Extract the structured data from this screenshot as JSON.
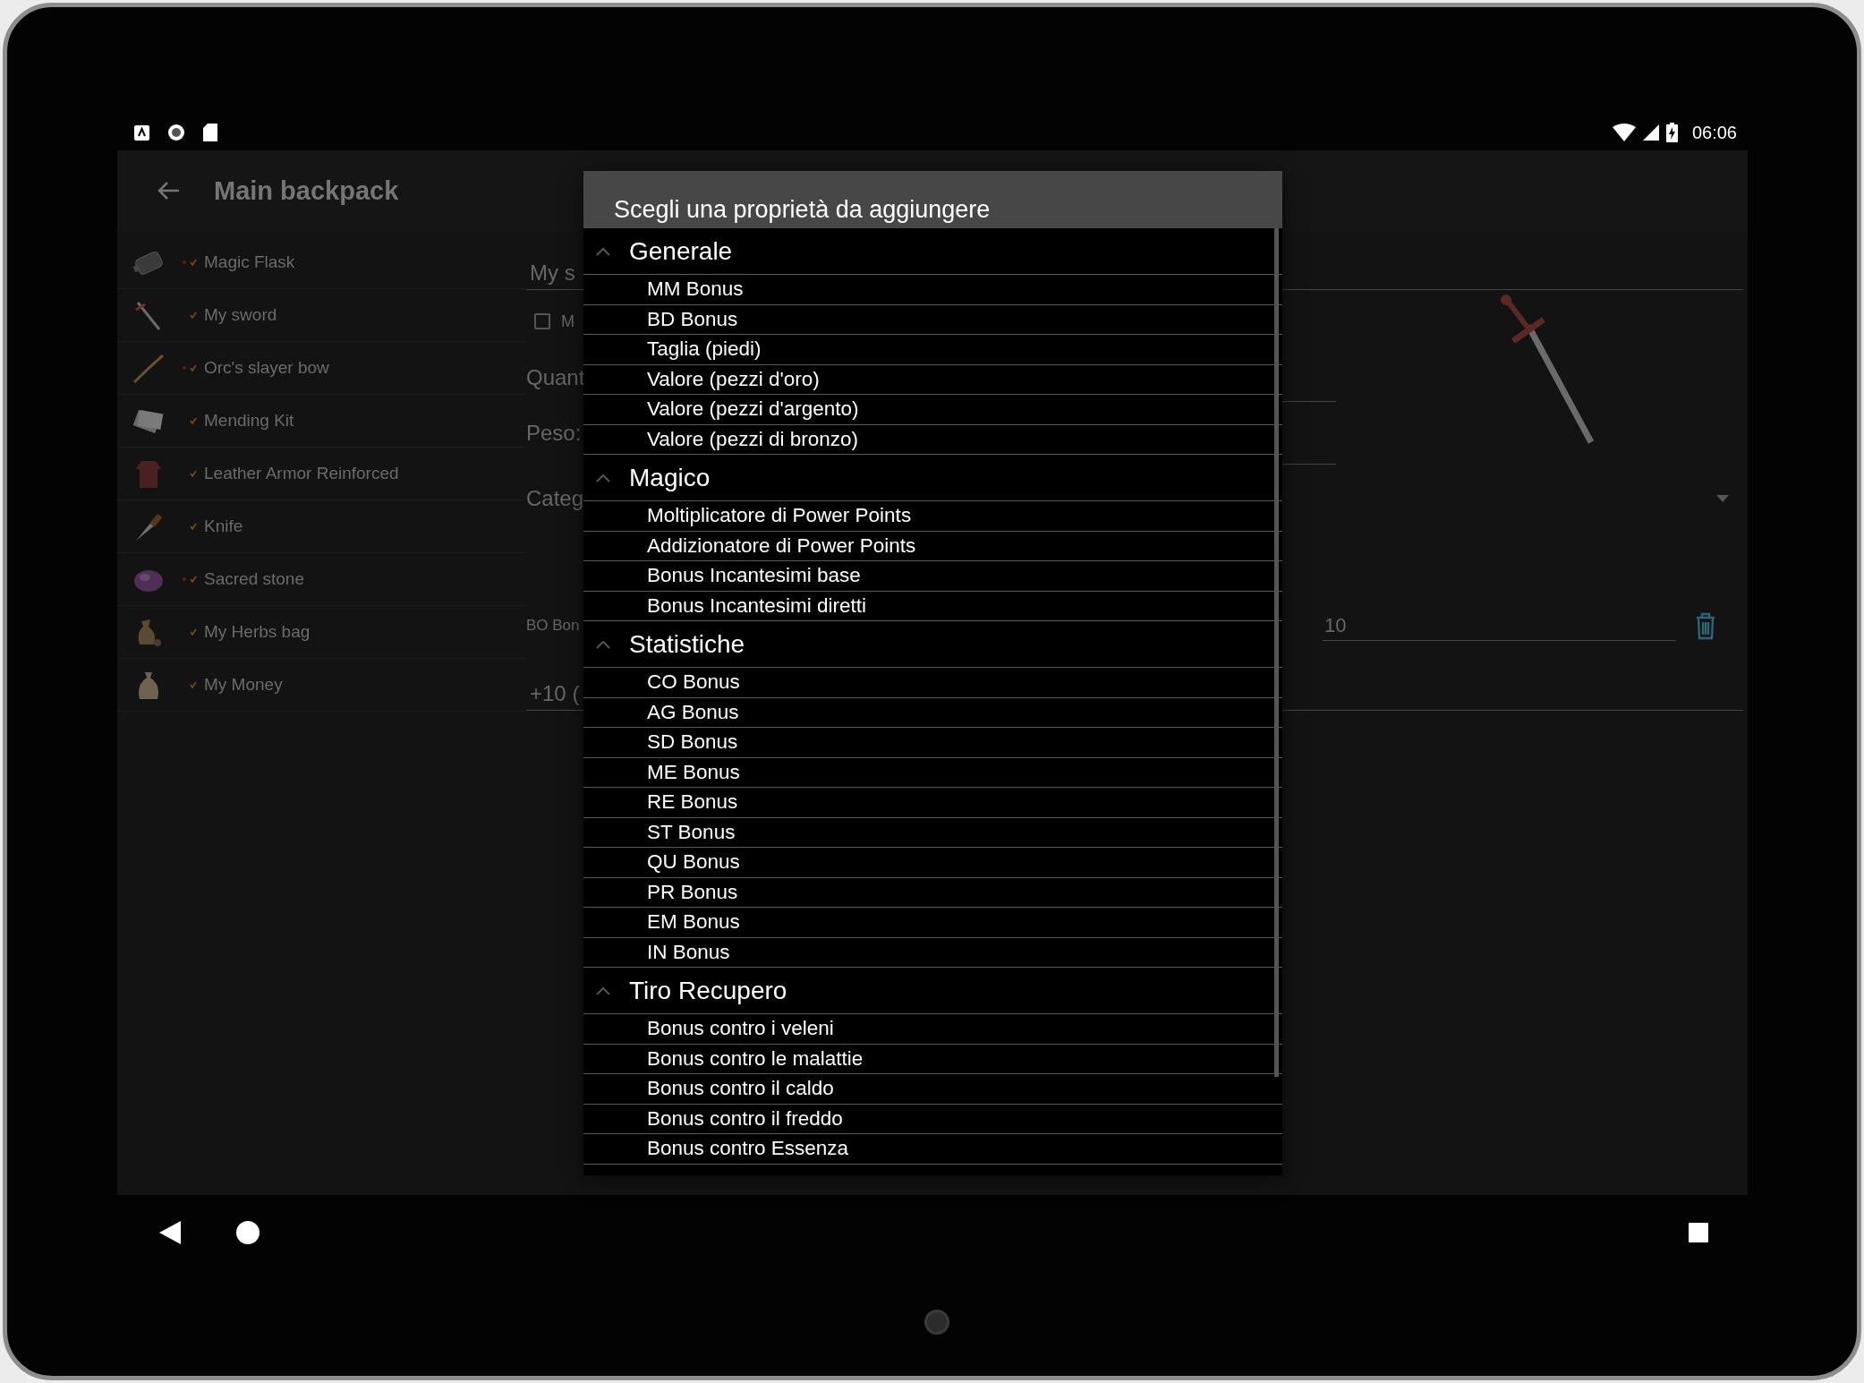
{
  "status_bar": {
    "time": "06:06"
  },
  "toolbar": {
    "title": "Main backpack"
  },
  "items": [
    {
      "name": "Magic Flask",
      "magic": true,
      "checked": true
    },
    {
      "name": "My sword",
      "magic": false,
      "checked": true
    },
    {
      "name": "Orc's slayer bow",
      "magic": true,
      "checked": true
    },
    {
      "name": "Mending Kit",
      "magic": false,
      "checked": true
    },
    {
      "name": "Leather Armor Reinforced",
      "magic": false,
      "checked": true
    },
    {
      "name": "Knife",
      "magic": false,
      "checked": true
    },
    {
      "name": "Sacred stone",
      "magic": true,
      "checked": true
    },
    {
      "name": "My Herbs bag",
      "magic": false,
      "checked": true
    },
    {
      "name": "My Money",
      "magic": false,
      "checked": true
    }
  ],
  "detail": {
    "name_field": "My s",
    "checkbox": {
      "label": "M",
      "checked": false
    },
    "quantity_label": "Quant",
    "weight_label": "Peso:",
    "category_label": "Categ",
    "bonus_label": "BO Bon",
    "bonus_value": "10",
    "bonus_summary": "+10 ("
  },
  "dialog": {
    "title": "Scegli una proprietà da aggiungere",
    "groups": [
      {
        "label": "Generale",
        "expanded": true,
        "items": [
          "MM Bonus",
          "BD Bonus",
          "Taglia (piedi)",
          "Valore (pezzi d'oro)",
          "Valore (pezzi d'argento)",
          "Valore (pezzi di bronzo)"
        ]
      },
      {
        "label": "Magico",
        "expanded": true,
        "items": [
          "Moltiplicatore di Power Points",
          "Addizionatore di Power Points",
          "Bonus Incantesimi base",
          "Bonus Incantesimi diretti"
        ]
      },
      {
        "label": "Statistiche",
        "expanded": true,
        "items": [
          "CO Bonus",
          "AG Bonus",
          "SD Bonus",
          "ME Bonus",
          "RE Bonus",
          "ST Bonus",
          "QU Bonus",
          "PR Bonus",
          "EM Bonus",
          "IN Bonus"
        ]
      },
      {
        "label": "Tiro Recupero",
        "expanded": true,
        "items": [
          "Bonus contro i veleni",
          "Bonus contro le malattie",
          "Bonus contro il caldo",
          "Bonus contro il freddo",
          "Bonus contro Essenza"
        ]
      }
    ]
  }
}
